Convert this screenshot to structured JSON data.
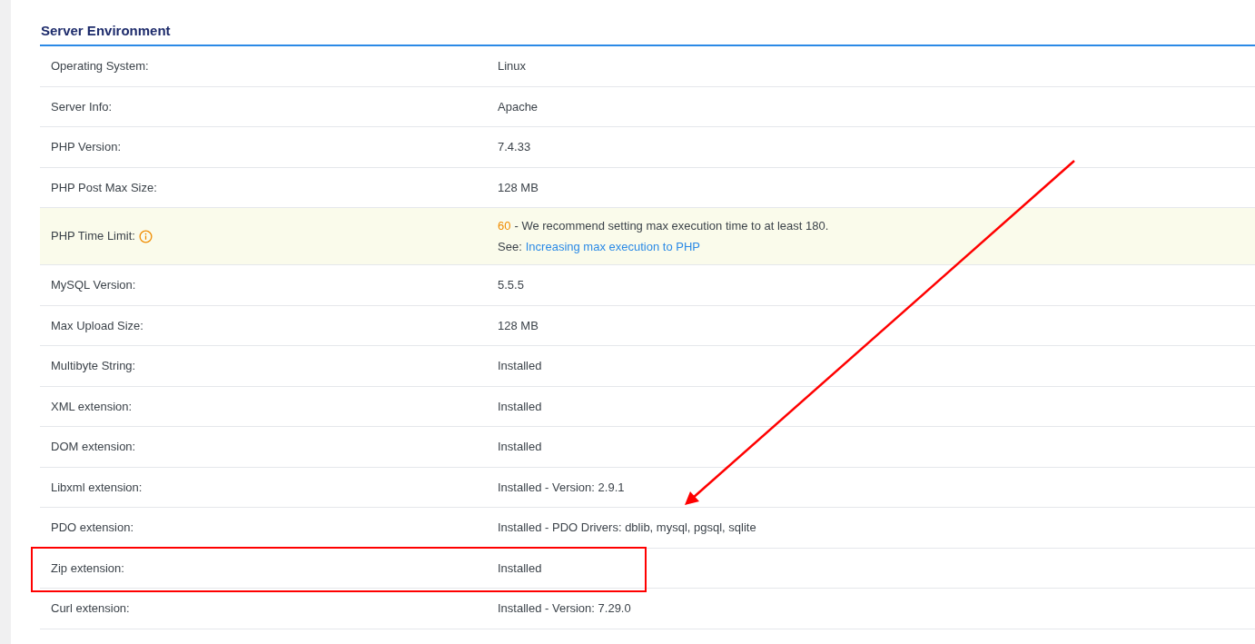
{
  "section": {
    "title": "Server Environment"
  },
  "rows": [
    {
      "kind": "plain",
      "label": "Operating System:",
      "value": "Linux",
      "highlighted": false
    },
    {
      "kind": "plain",
      "label": "Server Info:",
      "value": "Apache",
      "highlighted": false
    },
    {
      "kind": "plain",
      "label": "PHP Version:",
      "value": "7.4.33",
      "highlighted": false
    },
    {
      "kind": "plain",
      "label": "PHP Post Max Size:",
      "value": "128 MB",
      "highlighted": false
    },
    {
      "kind": "warning",
      "label": "PHP Time Limit:",
      "value": "60",
      "message": "- We recommend setting max execution time to at least 180.",
      "see_label": "See:",
      "link": "Increasing max execution to PHP",
      "highlighted": false
    },
    {
      "kind": "plain",
      "label": "MySQL Version:",
      "value": "5.5.5",
      "highlighted": false
    },
    {
      "kind": "plain",
      "label": "Max Upload Size:",
      "value": "128 MB",
      "highlighted": false
    },
    {
      "kind": "plain",
      "label": "Multibyte String:",
      "value": "Installed",
      "highlighted": false
    },
    {
      "kind": "plain",
      "label": "XML extension:",
      "value": "Installed",
      "highlighted": false
    },
    {
      "kind": "plain",
      "label": "DOM extension:",
      "value": "Installed",
      "highlighted": false
    },
    {
      "kind": "plain",
      "label": "Libxml extension:",
      "value": "Installed - Version: 2.9.1",
      "highlighted": false
    },
    {
      "kind": "plain",
      "label": "PDO extension:",
      "value": "Installed - PDO Drivers: dblib, mysql, pgsql, sqlite",
      "highlighted": false
    },
    {
      "kind": "plain",
      "label": "Zip extension:",
      "value": "Installed",
      "highlighted": true
    },
    {
      "kind": "plain",
      "label": "Curl extension:",
      "value": "Installed - Version: 7.29.0",
      "highlighted": false
    }
  ],
  "annotations": [
    {
      "kind": "arrow"
    }
  ]
}
